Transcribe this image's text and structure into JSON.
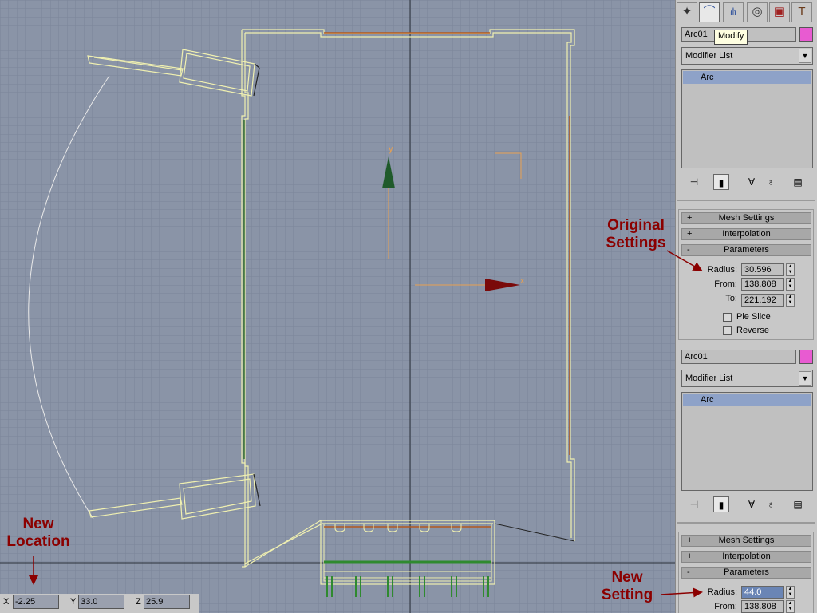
{
  "viewport": {
    "grid_color": "#7b8599",
    "background": "#8a94a7",
    "axis_labels": {
      "y": "y",
      "x": "x"
    },
    "coords": {
      "x_label": "X",
      "x_value": "-2.25",
      "y_label": "Y",
      "y_value": "33.0",
      "z_label": "Z",
      "z_value": "25.9"
    }
  },
  "command_panel": {
    "tabs": [
      {
        "icon": "create-icon"
      },
      {
        "icon": "modify-icon"
      },
      {
        "icon": "hierarchy-icon"
      },
      {
        "icon": "motion-icon"
      },
      {
        "icon": "display-icon"
      },
      {
        "icon": "utilities-icon"
      }
    ],
    "tooltip": "Modify",
    "top": {
      "object_name": "Arc01",
      "object_color": "#e85bd1",
      "modifier_list": "Modifier List",
      "stack_item": "Arc",
      "rollouts": [
        {
          "sign": "+",
          "label": "Mesh Settings"
        },
        {
          "sign": "+",
          "label": "Interpolation"
        },
        {
          "sign": "-",
          "label": "Parameters"
        }
      ],
      "params": {
        "radius_label": "Radius:",
        "radius_value": "30.596",
        "from_label": "From:",
        "from_value": "138.808",
        "to_label": "To:",
        "to_value": "221.192",
        "pie_slice_label": "Pie Slice",
        "pie_slice_checked": false,
        "reverse_label": "Reverse",
        "reverse_checked": false
      }
    },
    "bottom": {
      "object_name": "Arc01",
      "object_color": "#e85bd1",
      "modifier_list": "Modifier List",
      "stack_item": "Arc",
      "rollouts": [
        {
          "sign": "+",
          "label": "Mesh Settings"
        },
        {
          "sign": "+",
          "label": "Interpolation"
        },
        {
          "sign": "-",
          "label": "Parameters"
        }
      ],
      "params": {
        "radius_label": "Radius:",
        "radius_value": "44.0",
        "from_label": "From:",
        "from_value": "138.808"
      }
    }
  },
  "annotations": {
    "original_settings": "Original Settings",
    "new_location": "New Location",
    "new_setting": "New Setting",
    "color": "#8b0000"
  }
}
